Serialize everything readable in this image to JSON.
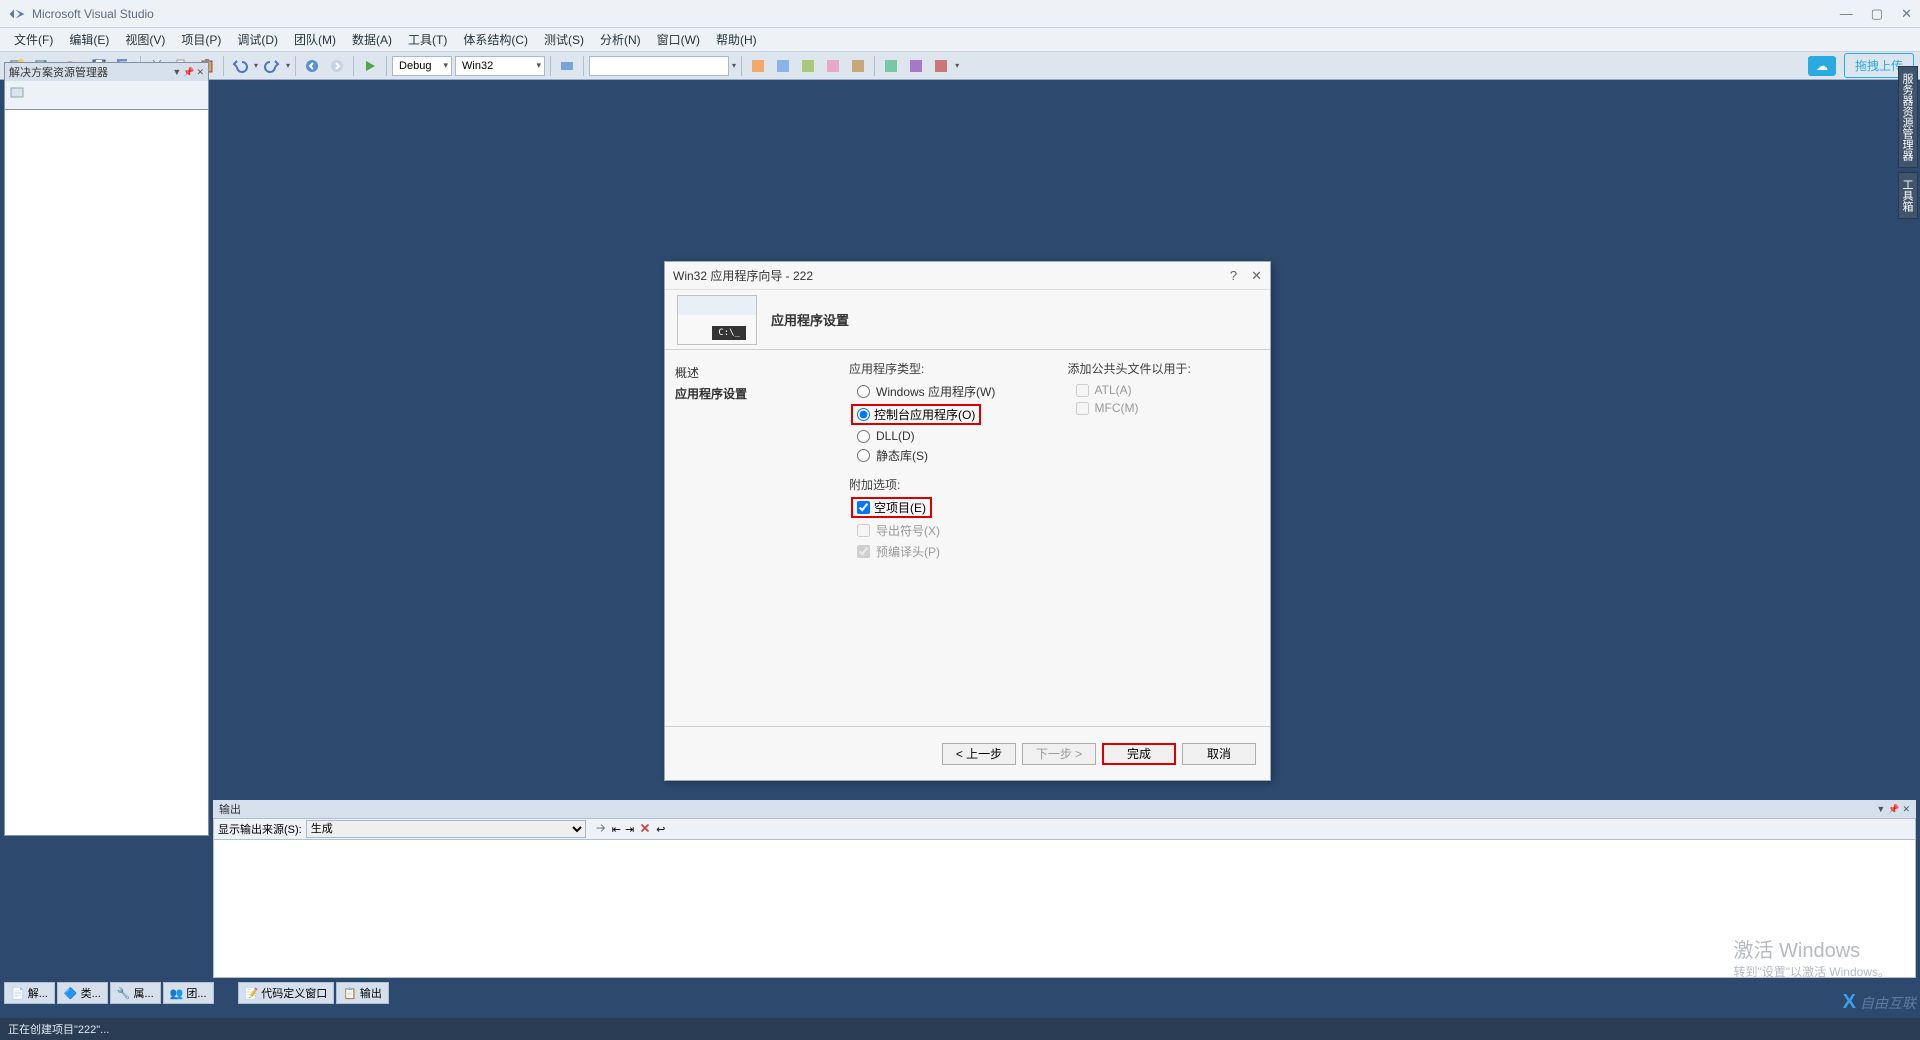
{
  "titlebar": {
    "app_name": "Microsoft Visual Studio"
  },
  "menubar": {
    "items": [
      "文件(F)",
      "编辑(E)",
      "视图(V)",
      "项目(P)",
      "调试(D)",
      "团队(M)",
      "数据(A)",
      "工具(T)",
      "体系结构(C)",
      "测试(S)",
      "分析(N)",
      "窗口(W)",
      "帮助(H)"
    ]
  },
  "toolbar": {
    "config": "Debug",
    "platform": "Win32",
    "upload": "拖拽上传"
  },
  "solution_explorer": {
    "title": "解决方案资源管理器"
  },
  "right_tabs": [
    "服务器资源管理器",
    "工具箱"
  ],
  "dialog": {
    "title": "Win32 应用程序向导 - 222",
    "header": "应用程序设置",
    "nav": {
      "overview": "概述",
      "settings": "应用程序设置"
    },
    "app_type": {
      "label": "应用程序类型:",
      "windows": "Windows 应用程序(W)",
      "console": "控制台应用程序(O)",
      "dll": "DLL(D)",
      "static": "静态库(S)"
    },
    "extra": {
      "label": "附加选项:",
      "empty": "空项目(E)",
      "export": "导出符号(X)",
      "pch": "预编译头(P)"
    },
    "headers": {
      "label": "添加公共头文件以用于:",
      "atl": "ATL(A)",
      "mfc": "MFC(M)"
    },
    "footer": {
      "prev": "< 上一步",
      "next": "下一步 >",
      "finish": "完成",
      "cancel": "取消"
    }
  },
  "output": {
    "title": "输出",
    "source_label": "显示输出来源(S):",
    "source_value": "生成"
  },
  "bottom_tabs": [
    "解...",
    "类...",
    "属...",
    "团...",
    "代码定义窗口",
    "输出"
  ],
  "statusbar": {
    "message": "正在创建项目\"222\"..."
  },
  "watermark": {
    "activate_title": "激活 Windows",
    "activate_sub": "转到\"设置\"以激活 Windows。",
    "logo": "自由互联"
  }
}
